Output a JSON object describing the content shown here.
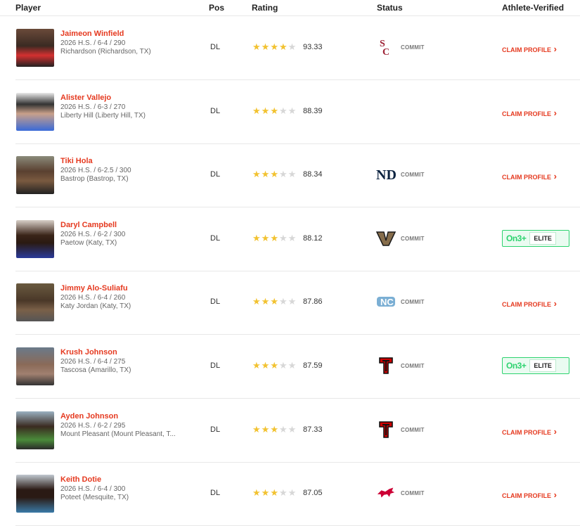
{
  "headers": {
    "player": "Player",
    "pos": "Pos",
    "rating": "Rating",
    "status": "Status",
    "verified": "Athlete-Verified"
  },
  "status_label": "COMMIT",
  "claim_label": "CLAIM PROFILE",
  "elite": {
    "brand": "On3+",
    "badge": "ELITE"
  },
  "colors": {
    "accent": "#e5391f",
    "star": "#f2c230",
    "elite": "#2dd36f"
  },
  "players": [
    {
      "name": "Jaimeon Winfield",
      "class_line": "2026 H.S. / 6-4 / 290",
      "school": "Richardson (Richardson, TX)",
      "pos": "DL",
      "stars": 4,
      "rating": "93.33",
      "school_logo": "usc-logo",
      "verified": "claim"
    },
    {
      "name": "Alister Vallejo",
      "class_line": "2026 H.S. / 6-3 / 270",
      "school": "Liberty Hill (Liberty Hill, TX)",
      "pos": "DL",
      "stars": 3,
      "rating": "88.39",
      "school_logo": "",
      "verified": "claim"
    },
    {
      "name": "Tiki Hola",
      "class_line": "2026 H.S. / 6-2.5 / 300",
      "school": "Bastrop (Bastrop, TX)",
      "pos": "DL",
      "stars": 3,
      "rating": "88.34",
      "school_logo": "notre-dame-logo",
      "verified": "claim"
    },
    {
      "name": "Daryl Campbell",
      "class_line": "2026 H.S. / 6-2 / 300",
      "school": "Paetow (Katy, TX)",
      "pos": "DL",
      "stars": 3,
      "rating": "88.12",
      "school_logo": "vanderbilt-logo",
      "verified": "elite"
    },
    {
      "name": "Jimmy Alo-Suliafu",
      "class_line": "2026 H.S. / 6-4 / 260",
      "school": "Katy Jordan (Katy, TX)",
      "pos": "DL",
      "stars": 3,
      "rating": "87.86",
      "school_logo": "north-carolina-logo",
      "verified": "claim"
    },
    {
      "name": "Krush Johnson",
      "class_line": "2026 H.S. / 6-4 / 275",
      "school": "Tascosa (Amarillo, TX)",
      "pos": "DL",
      "stars": 3,
      "rating": "87.59",
      "school_logo": "texas-tech-logo",
      "verified": "elite"
    },
    {
      "name": "Ayden Johnson",
      "class_line": "2026 H.S. / 6-2 / 295",
      "school": "Mount Pleasant (Mount Pleasant, T...",
      "pos": "DL",
      "stars": 3,
      "rating": "87.33",
      "school_logo": "texas-tech-logo",
      "verified": "claim"
    },
    {
      "name": "Keith Dotie",
      "class_line": "2026 H.S. / 6-4 / 300",
      "school": "Poteet (Mesquite, TX)",
      "pos": "DL",
      "stars": 3,
      "rating": "87.05",
      "school_logo": "smu-logo",
      "verified": "claim"
    }
  ]
}
